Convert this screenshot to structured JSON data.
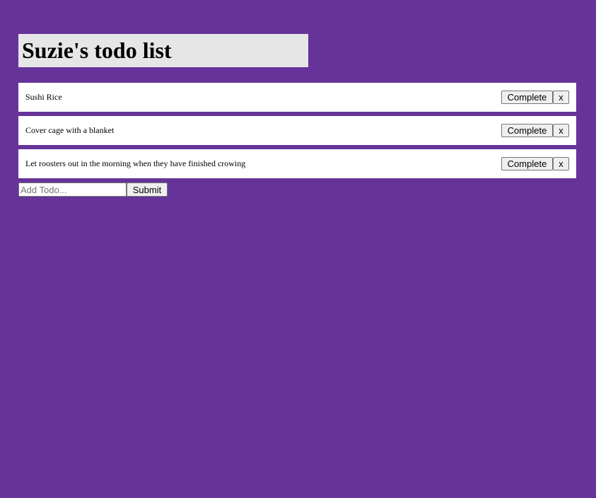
{
  "header": {
    "title": "Suzie's todo list"
  },
  "todos": [
    {
      "text": "Sushi Rice",
      "complete_label": "Complete",
      "delete_label": "x"
    },
    {
      "text": "Cover cage with a blanket",
      "complete_label": "Complete",
      "delete_label": "x"
    },
    {
      "text": "Let roosters out in the morning when they have finished crowing",
      "complete_label": "Complete",
      "delete_label": "x"
    }
  ],
  "form": {
    "input_value": "",
    "input_placeholder": "Add Todo...",
    "submit_label": "Submit"
  },
  "colors": {
    "background": "#663399",
    "title_bg": "#e6e6e6",
    "item_bg": "#ffffff"
  }
}
